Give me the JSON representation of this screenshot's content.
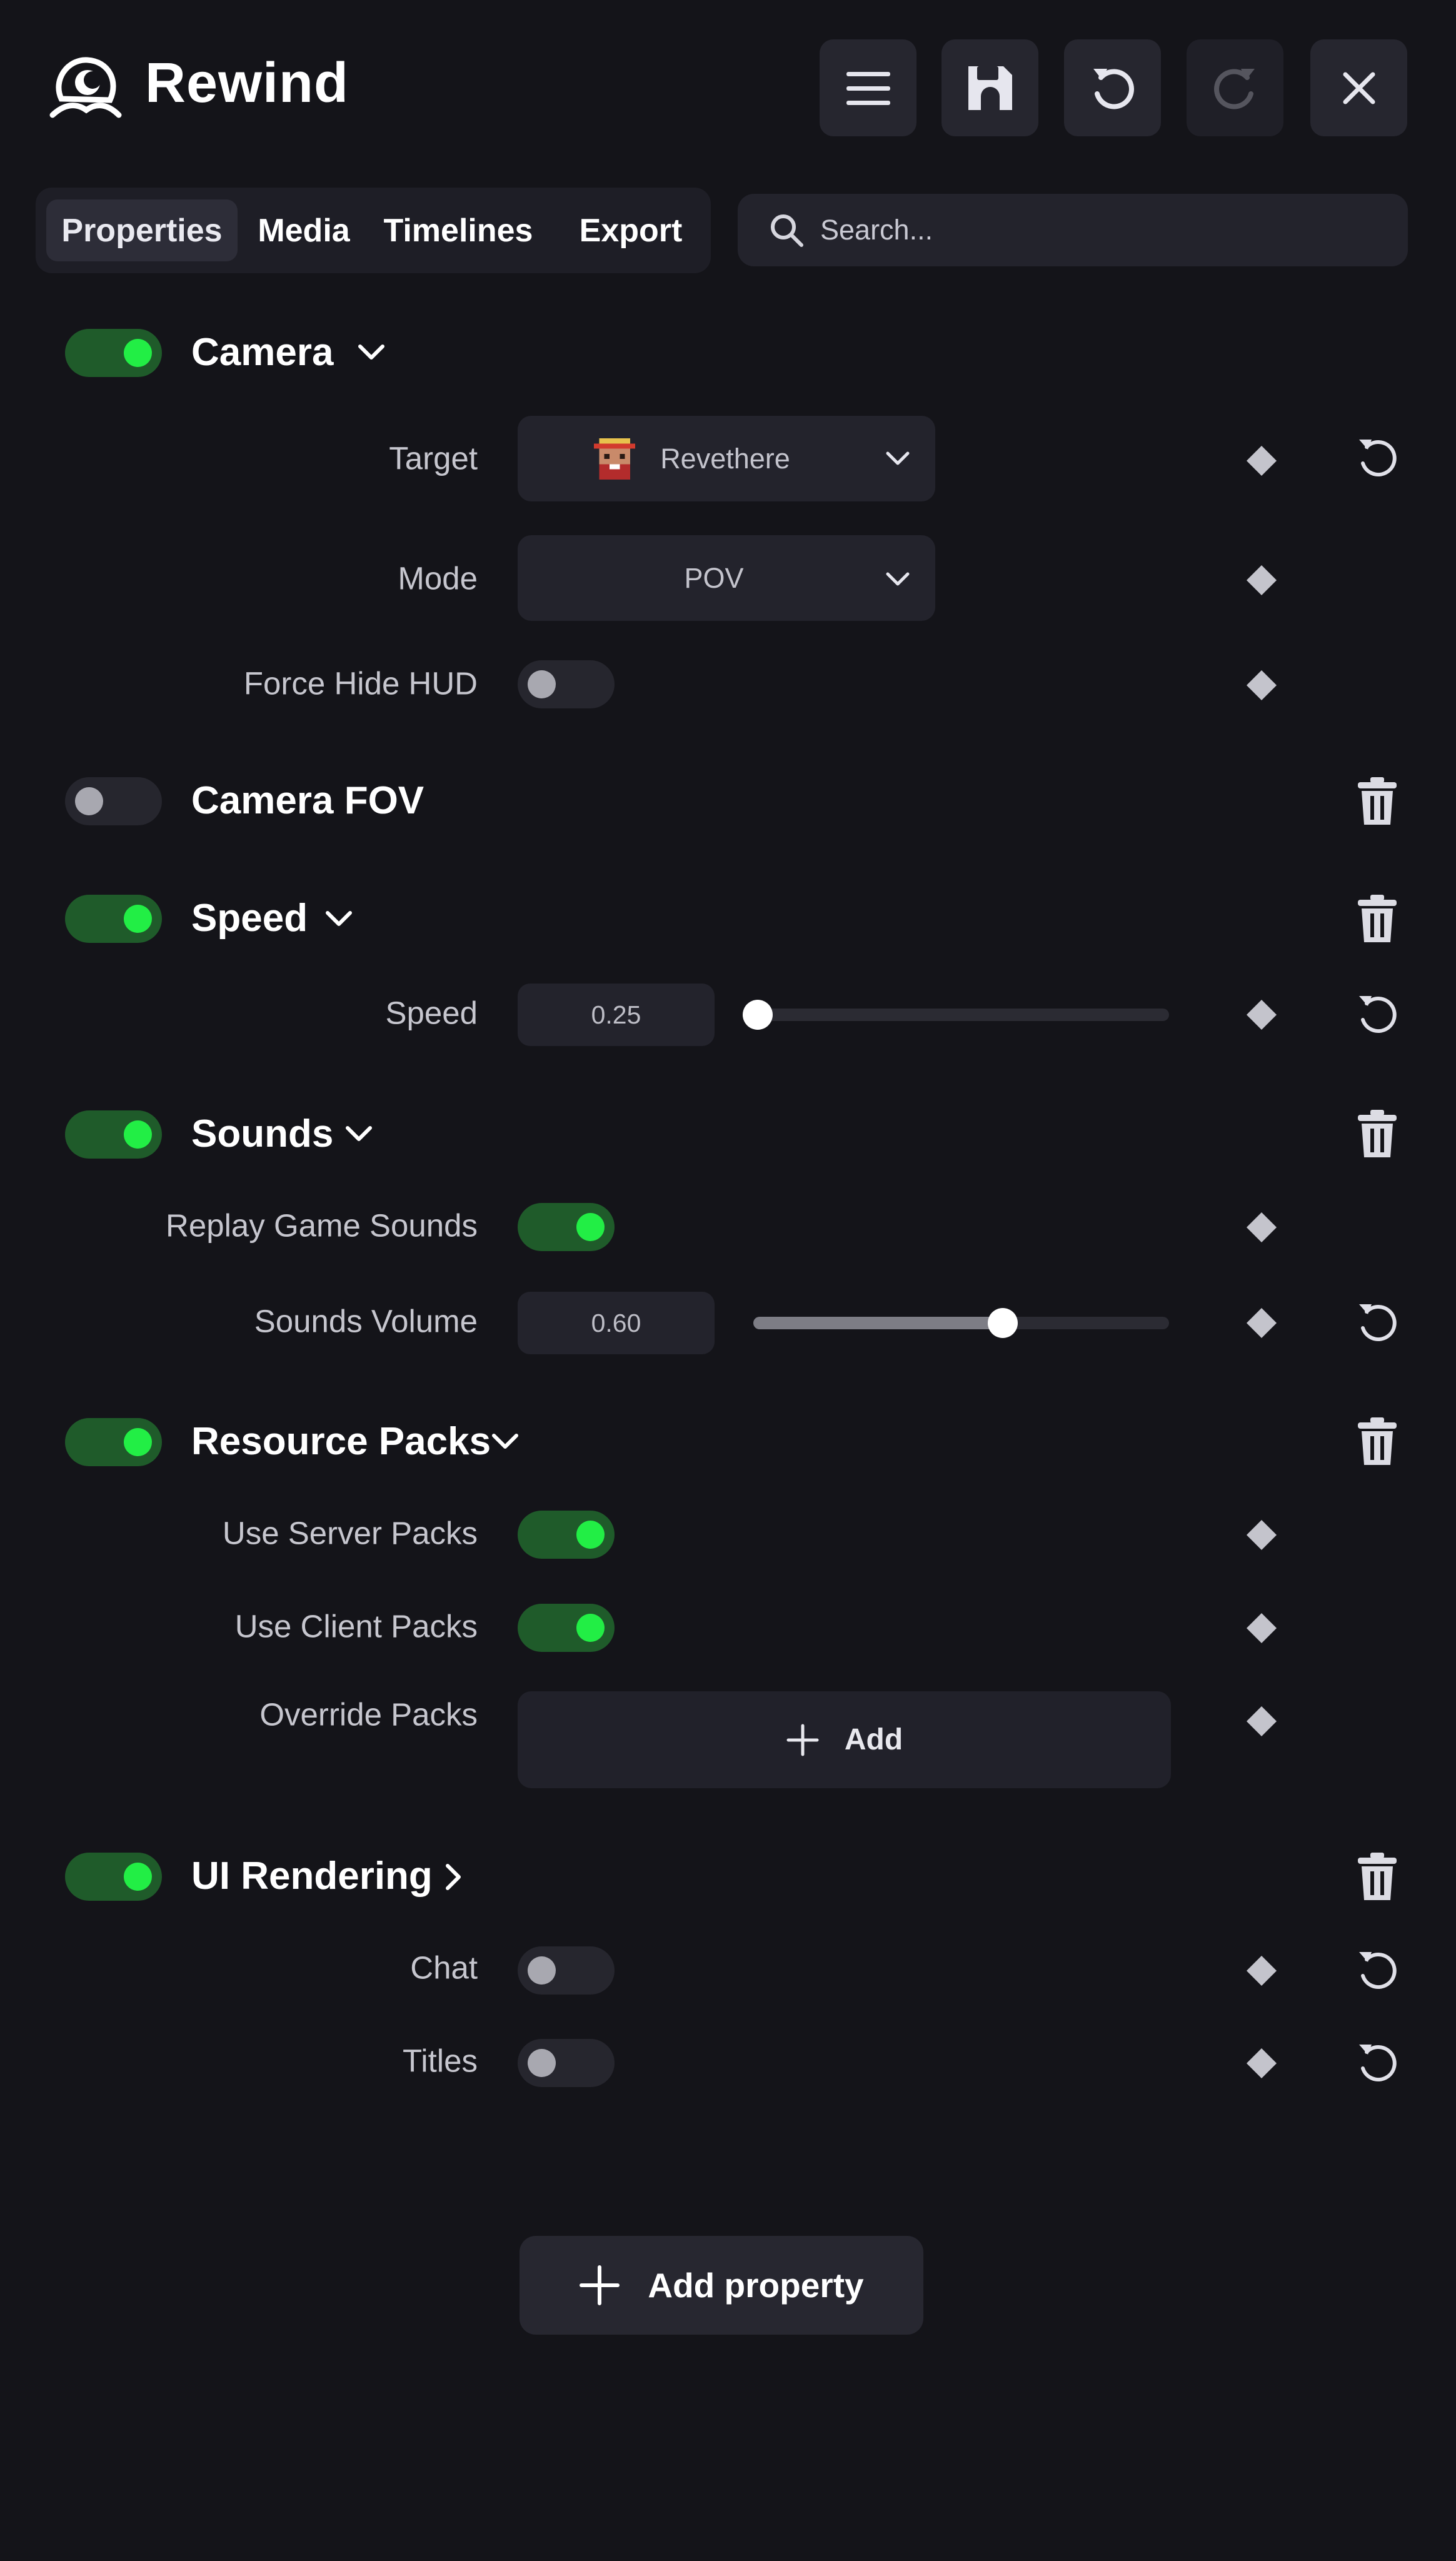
{
  "app": {
    "title": "Rewind"
  },
  "header": {
    "menu_icon": "hamburger-menu-icon",
    "save_icon": "floppy-disk-icon",
    "undo_icon": "undo-icon",
    "redo_icon": "redo-icon",
    "close_icon": "close-icon"
  },
  "tabs": [
    {
      "label": "Properties",
      "active": true
    },
    {
      "label": "Media",
      "active": false
    },
    {
      "label": "Timelines",
      "active": false
    },
    {
      "label": "Export",
      "active": false
    }
  ],
  "search": {
    "placeholder": "Search..."
  },
  "colors": {
    "background": "#141419",
    "toggle_on": "#22ee45",
    "toggle_on_track": "#1f5b2a",
    "panel": "#23232c"
  },
  "camera": {
    "title": "Camera",
    "enabled": true,
    "target_label": "Target",
    "target_value": "Revethere",
    "mode_label": "Mode",
    "mode_value": "POV",
    "hud_label": "Force Hide HUD",
    "hud_enabled": false
  },
  "camera_fov": {
    "title": "Camera FOV",
    "enabled": false
  },
  "speed": {
    "title": "Speed",
    "enabled": true,
    "speed_label": "Speed",
    "speed_value": "0.25",
    "speed_fraction": 0.01
  },
  "sounds": {
    "title": "Sounds",
    "enabled": true,
    "replay_label": "Replay Game Sounds",
    "replay_enabled": true,
    "volume_label": "Sounds Volume",
    "volume_value": "0.60",
    "volume_fraction": 0.6
  },
  "resource_packs": {
    "title": "Resource Packs",
    "enabled": true,
    "server_label": "Use Server Packs",
    "server_enabled": true,
    "client_label": "Use Client Packs",
    "client_enabled": true,
    "override_label": "Override Packs",
    "add_label": "Add"
  },
  "ui_rendering": {
    "title": "UI Rendering",
    "enabled": true,
    "chat_label": "Chat",
    "chat_enabled": false,
    "titles_label": "Titles",
    "titles_enabled": false
  },
  "footer": {
    "add_property_label": "Add property"
  }
}
